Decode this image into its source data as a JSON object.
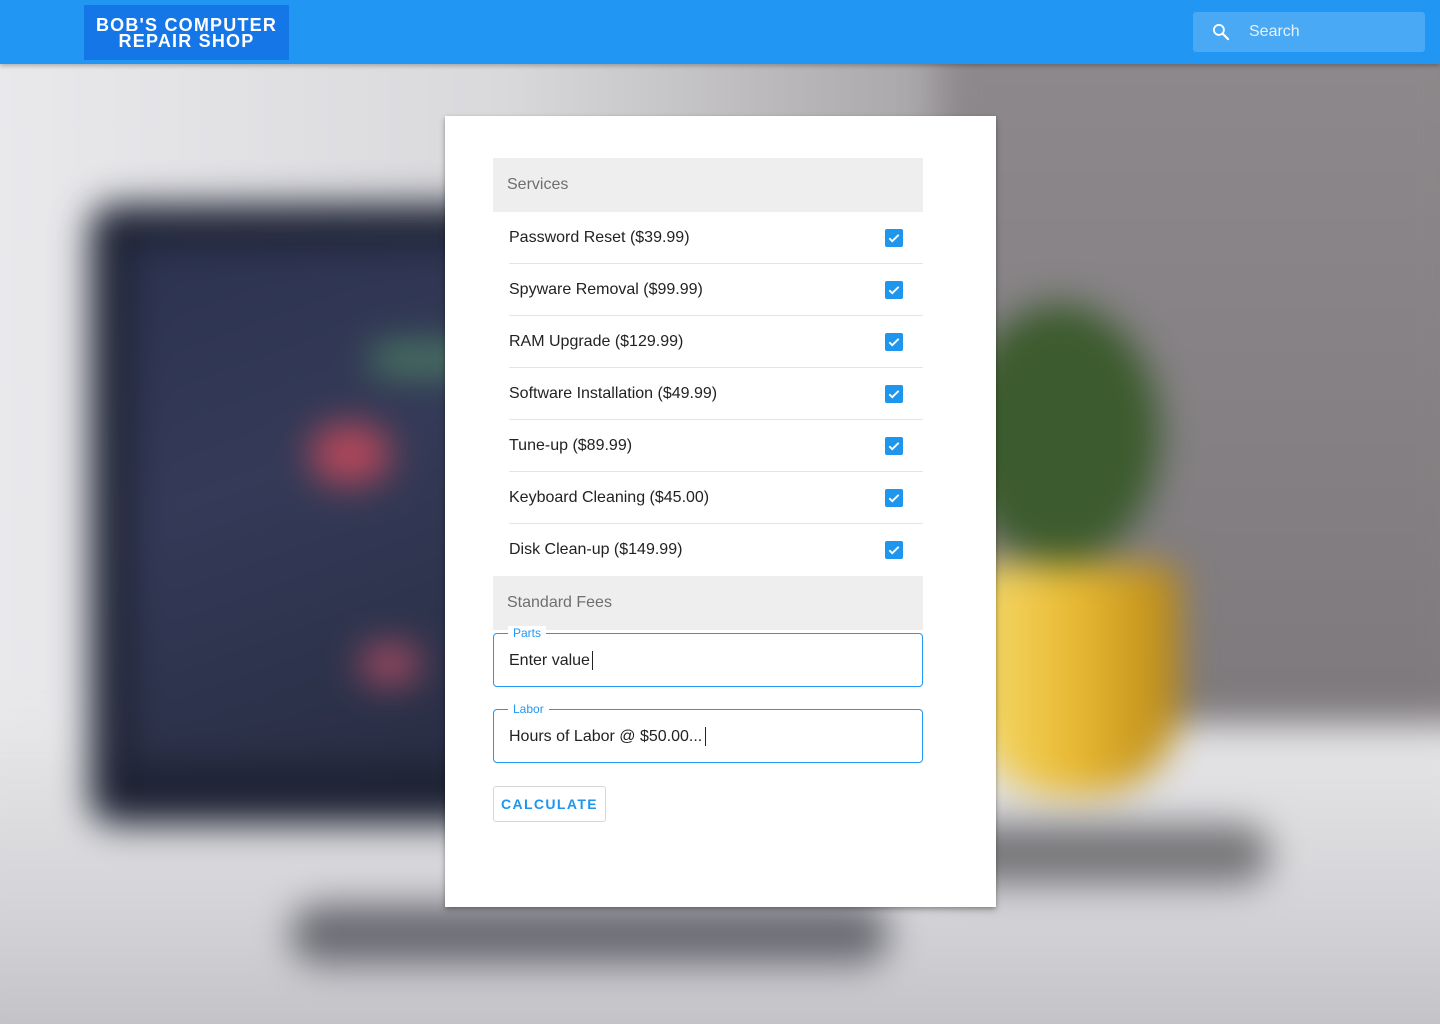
{
  "header": {
    "logo_line1": "BOB'S COMPUTER",
    "logo_line2": "REPAIR SHOP",
    "search_placeholder": "Search",
    "search_icon": "search-icon",
    "colors": {
      "bar": "#2196f3",
      "logo_bg": "#1576e8"
    }
  },
  "form": {
    "services_header": "Services",
    "services": [
      {
        "label": "Password Reset ($39.99)",
        "checked": true
      },
      {
        "label": "Spyware Removal ($99.99)",
        "checked": true
      },
      {
        "label": "RAM Upgrade ($129.99)",
        "checked": true
      },
      {
        "label": "Software Installation ($49.99)",
        "checked": true
      },
      {
        "label": "Tune-up ($89.99)",
        "checked": true
      },
      {
        "label": "Keyboard Cleaning ($45.00)",
        "checked": true
      },
      {
        "label": "Disk Clean-up ($149.99)",
        "checked": true
      }
    ],
    "fees_header": "Standard Fees",
    "parts": {
      "label": "Parts",
      "value": "Enter value"
    },
    "labor": {
      "label": "Labor",
      "value": "Hours of Labor @ $50.00..."
    },
    "calculate_label": "CALCULATE",
    "accent_color": "#2196f3"
  }
}
